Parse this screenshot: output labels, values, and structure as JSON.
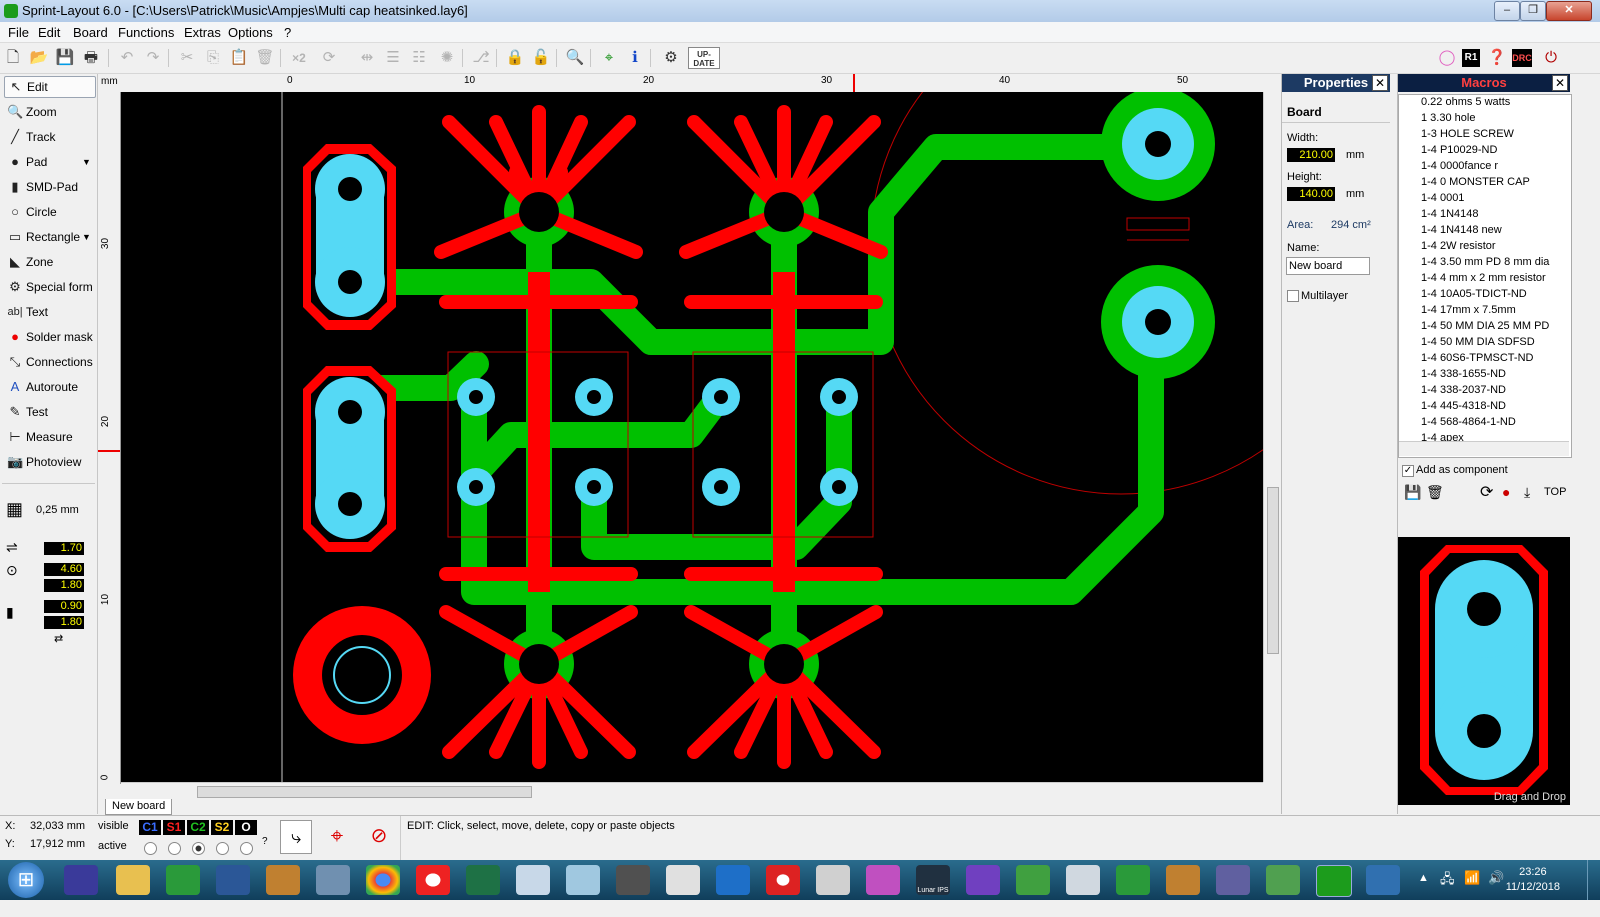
{
  "window": {
    "title": "Sprint-Layout 6.0 - [C:\\Users\\Patrick\\Music\\Ampjes\\Multi cap heatsinked.lay6]",
    "buttons": [
      "minimize",
      "restore",
      "close"
    ]
  },
  "menu": [
    "File",
    "Edit",
    "Board",
    "Functions",
    "Extras",
    "Options",
    "?"
  ],
  "toolbar": {
    "icons": [
      "new-file",
      "open-folder",
      "save",
      "print",
      "undo",
      "redo",
      "cut",
      "copy",
      "paste",
      "delete",
      "duplicate-x2",
      "rotate",
      "mirror-h",
      "align",
      "distribute",
      "group",
      "route",
      "mask",
      "lock",
      "zoom",
      "snap",
      "info",
      "component",
      "update"
    ],
    "x2_label": "×2",
    "update_label": "UP-DATE",
    "right_icons": [
      "pink-circle",
      "r1",
      "help",
      "drc",
      "exit"
    ]
  },
  "tools": {
    "items": [
      {
        "label": "Edit",
        "icon": "cursor-icon",
        "active": true
      },
      {
        "label": "Zoom",
        "icon": "zoom-icon"
      },
      {
        "label": "Track",
        "icon": "track-icon"
      },
      {
        "label": "Pad",
        "icon": "pad-icon",
        "dropdown": true
      },
      {
        "label": "SMD-Pad",
        "icon": "smd-pad-icon"
      },
      {
        "label": "Circle",
        "icon": "circle-icon"
      },
      {
        "label": "Rectangle",
        "icon": "rectangle-icon",
        "dropdown": true
      },
      {
        "label": "Zone",
        "icon": "zone-icon"
      },
      {
        "label": "Special form",
        "icon": "special-form-icon"
      },
      {
        "label": "Text",
        "icon": "text-icon"
      },
      {
        "label": "Solder mask",
        "icon": "solder-mask-icon"
      },
      {
        "label": "Connections",
        "icon": "connections-icon"
      },
      {
        "label": "Autoroute",
        "icon": "autoroute-icon"
      },
      {
        "label": "Test",
        "icon": "test-icon"
      },
      {
        "label": "Measure",
        "icon": "measure-icon"
      },
      {
        "label": "Photoview",
        "icon": "photoview-icon"
      }
    ],
    "grid": "0,25 mm",
    "track_width": "1.70",
    "pad_outer": "4.60",
    "pad_inner": "1.80",
    "smd_w": "0.90",
    "smd_h": "1.80"
  },
  "ruler": {
    "unit": "mm",
    "top_labels": [
      "0",
      "10",
      "20",
      "30",
      "40",
      "50"
    ],
    "left_labels": [
      "30",
      "20",
      "10",
      "0"
    ]
  },
  "board_tab": "New board",
  "properties": {
    "title": "Properties",
    "section": "Board",
    "width_label": "Width:",
    "width_value": "210.00",
    "height_label": "Height:",
    "height_value": "140.00",
    "unit": "mm",
    "area_label": "Area:",
    "area_value": "294 cm²",
    "name_label": "Name:",
    "name_value": "New board",
    "multilayer_label": "Multilayer"
  },
  "macros": {
    "title": "Macros",
    "items": [
      "0.22 ohms 5 watts",
      "1 3.30 hole",
      "1-3 HOLE SCREW",
      "1-4  P10029-ND",
      "1-4 0000fance r",
      "1-4 0 MONSTER CAP",
      "1-4 0001",
      "1-4 1N4148",
      "1-4 1N4148 new",
      "1-4 2W resistor",
      "1-4 3.50 mm PD 8 mm dia",
      "1-4 4 mm x 2 mm resistor",
      "1-4 10A05-TDICT-ND",
      "1-4 17mm x 7.5mm",
      "1-4 50 MM DIA 25 MM PD",
      "1-4 50 MM DIA SDFSD",
      "1-4 60S6-TPMSCT-ND",
      "1-4 338-1655-ND",
      "1-4 338-2037-ND",
      "1-4 445-4318-ND",
      "1-4 568-4864-1-ND",
      "1-4 apex"
    ],
    "add_component_label": "Add as component",
    "top_label": "TOP",
    "drag_drop_label": "Drag and Drop"
  },
  "status": {
    "x_label": "X:",
    "x_value": "32,033 mm",
    "y_label": "Y:",
    "y_value": "17,912 mm",
    "visible_label": "visible",
    "active_label": "active",
    "layers": [
      {
        "name": "C1",
        "color": "#3a6dff"
      },
      {
        "name": "S1",
        "color": "#ff2020"
      },
      {
        "name": "C2",
        "color": "#20c020"
      },
      {
        "name": "S2",
        "color": "#ffd020"
      },
      {
        "name": "O",
        "color": "#ffffff"
      }
    ],
    "question": "?",
    "message": "EDIT:  Click, select, move, delete, copy or paste objects"
  },
  "taskbar": {
    "time": "23:26",
    "date": "11/12/2018",
    "lunar_label": "Lunar IPS"
  },
  "colors": {
    "copper_top": "#ff0000",
    "copper_bottom": "#00c000",
    "pad": "#55d9f5",
    "board": "#000000"
  }
}
